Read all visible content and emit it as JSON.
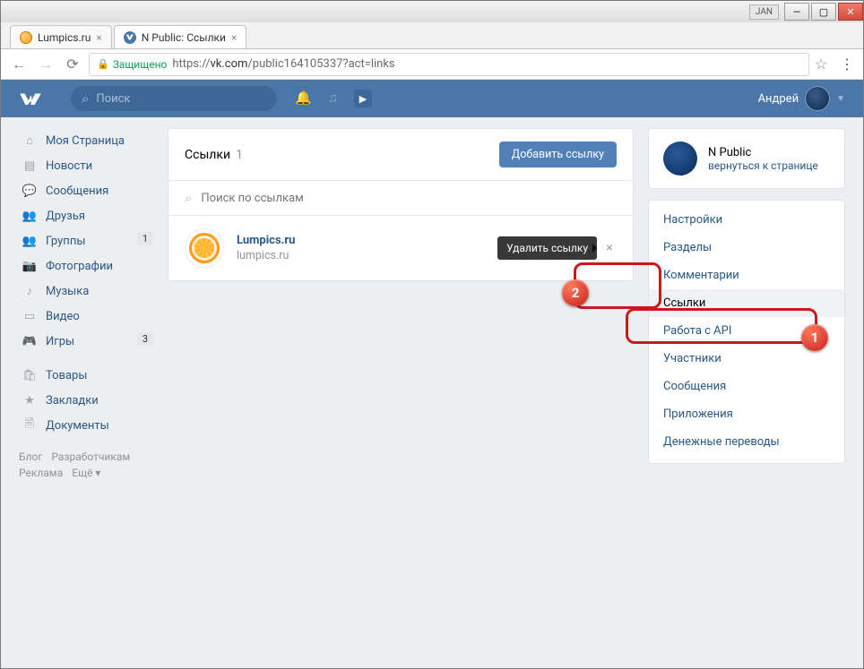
{
  "titlebar": {
    "jan": "JAN"
  },
  "tabs": [
    {
      "label": "Lumpics.ru",
      "favicon": "orange"
    },
    {
      "label": "N Public: Ссылки",
      "favicon": "vk"
    }
  ],
  "addressbar": {
    "secure_label": "Защищено",
    "url_proto": "https://",
    "url_host": "vk.com",
    "url_path": "/public164105337?act=links"
  },
  "vk_header": {
    "search_placeholder": "Поиск",
    "username": "Андрей"
  },
  "sidebar": {
    "items": [
      {
        "icon": "home-icon",
        "glyph": "⌂",
        "label": "Моя Страница"
      },
      {
        "icon": "news-icon",
        "glyph": "▤",
        "label": "Новости"
      },
      {
        "icon": "messages-icon",
        "glyph": "💬",
        "label": "Сообщения"
      },
      {
        "icon": "friends-icon",
        "glyph": "👥",
        "label": "Друзья"
      },
      {
        "icon": "groups-icon",
        "glyph": "👥",
        "label": "Группы",
        "badge": "1"
      },
      {
        "icon": "photos-icon",
        "glyph": "📷",
        "label": "Фотографии"
      },
      {
        "icon": "music-icon",
        "glyph": "♪",
        "label": "Музыка"
      },
      {
        "icon": "video-icon",
        "glyph": "▭",
        "label": "Видео"
      },
      {
        "icon": "games-icon",
        "glyph": "🎮",
        "label": "Игры",
        "badge": "3"
      }
    ],
    "items2": [
      {
        "icon": "market-icon",
        "glyph": "🛍",
        "label": "Товары"
      },
      {
        "icon": "bookmarks-icon",
        "glyph": "★",
        "label": "Закладки"
      },
      {
        "icon": "docs-icon",
        "glyph": "🗎",
        "label": "Документы"
      }
    ],
    "footer": [
      "Блог",
      "Разработчикам",
      "Реклама",
      "Ещё ▾"
    ]
  },
  "links_panel": {
    "title": "Ссылки",
    "count": "1",
    "add_button": "Добавить ссылку",
    "search_placeholder": "Поиск по ссылкам",
    "row": {
      "name": "Lumpics.ru",
      "url": "lumpics.ru",
      "delete_tooltip": "Удалить ссылку"
    }
  },
  "right_panel": {
    "title": "N Public",
    "subtitle": "вернуться к странице",
    "menu": [
      "Настройки",
      "Разделы",
      "Комментарии",
      "Ссылки",
      "Работа с API",
      "Участники",
      "Сообщения",
      "Приложения",
      "Денежные переводы"
    ],
    "active_index": 3
  },
  "annotations": {
    "one": "1",
    "two": "2"
  }
}
